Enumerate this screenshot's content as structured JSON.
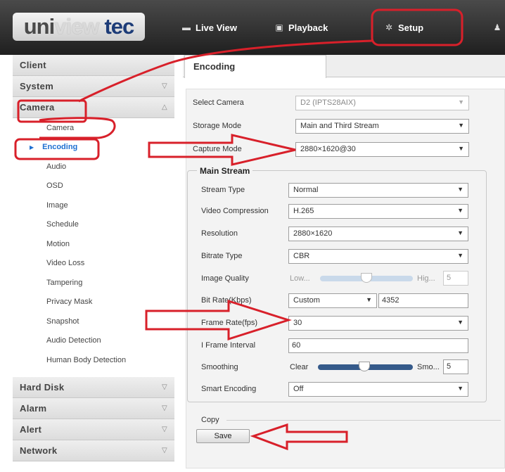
{
  "header": {
    "logo": {
      "part1": "uni",
      "part2": "view",
      "part3": "tec"
    },
    "nav": [
      {
        "label": "Live View",
        "icon": "monitor-icon"
      },
      {
        "label": "Playback",
        "icon": "film-icon"
      },
      {
        "label": "Setup",
        "icon": "gear-icon"
      }
    ]
  },
  "sidebar": {
    "groups": [
      {
        "label": "Client",
        "chevron": ""
      },
      {
        "label": "System",
        "chevron": "down"
      },
      {
        "label": "Camera",
        "chevron": "up"
      }
    ],
    "camera_items": [
      "Camera",
      "Encoding",
      "Audio",
      "OSD",
      "Image",
      "Schedule",
      "Motion",
      "Video Loss",
      "Tampering",
      "Privacy Mask",
      "Snapshot",
      "Audio Detection",
      "Human Body Detection"
    ],
    "active_item": "Encoding",
    "bottom_groups": [
      {
        "label": "Hard Disk"
      },
      {
        "label": "Alarm"
      },
      {
        "label": "Alert"
      },
      {
        "label": "Network"
      }
    ]
  },
  "main": {
    "tab": "Encoding",
    "select_camera": {
      "label": "Select Camera",
      "value": "D2 (IPTS28AIX)"
    },
    "storage_mode": {
      "label": "Storage Mode",
      "value": "Main and Third Stream"
    },
    "capture_mode": {
      "label": "Capture Mode",
      "value": "2880×1620@30"
    },
    "main_stream": {
      "legend": "Main Stream",
      "stream_type": {
        "label": "Stream Type",
        "value": "Normal"
      },
      "video_compression": {
        "label": "Video Compression",
        "value": "H.265"
      },
      "resolution": {
        "label": "Resolution",
        "value": "2880×1620"
      },
      "bitrate_type": {
        "label": "Bitrate Type",
        "value": "CBR"
      },
      "image_quality": {
        "label": "Image Quality",
        "low": "Low...",
        "high": "Hig...",
        "value": "5"
      },
      "bit_rate": {
        "label": "Bit Rate(Kbps)",
        "mode": "Custom",
        "value": "4352"
      },
      "frame_rate": {
        "label": "Frame Rate(fps)",
        "value": "30"
      },
      "i_frame_interval": {
        "label": "I Frame Interval",
        "value": "60"
      },
      "smoothing": {
        "label": "Smoothing",
        "low": "Clear",
        "high": "Smo...",
        "value": "5"
      },
      "smart_encoding": {
        "label": "Smart Encoding",
        "value": "Off"
      }
    },
    "copy_label": "Copy",
    "save_label": "Save"
  },
  "colors": {
    "accent": "#1d6fd1",
    "annotation": "#d8202a",
    "header_bg": "#2b2b2b"
  }
}
